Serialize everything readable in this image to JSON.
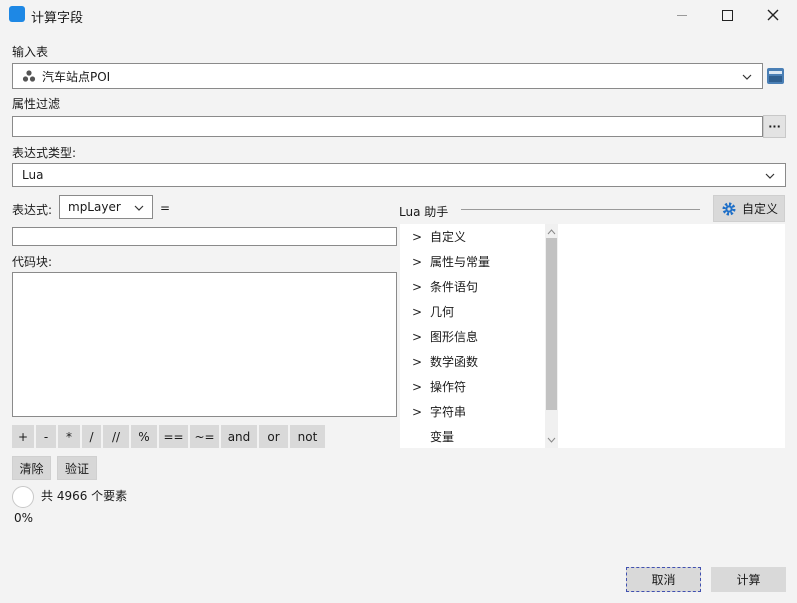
{
  "window": {
    "title": "计算字段",
    "minimize_icon": "minimize-icon",
    "maximize_icon": "maximize-icon",
    "close_icon": "close-icon"
  },
  "input_table": {
    "label": "输入表",
    "value": "汽车站点POI",
    "icon": "point-layer-icon"
  },
  "attr_filter": {
    "label": "属性过滤",
    "value": "",
    "button": "···"
  },
  "expr_type": {
    "label": "表达式类型:",
    "value": "Lua"
  },
  "expression": {
    "label": "表达式:",
    "field": "mpLayer",
    "equals": "=",
    "value": ""
  },
  "code_block": {
    "label": "代码块:",
    "value": ""
  },
  "operators": [
    "+",
    "-",
    "*",
    "/",
    "//",
    "%",
    "==",
    "~=",
    "and",
    "or",
    "not"
  ],
  "actions": {
    "clear": "清除",
    "verify": "验证"
  },
  "progress": {
    "count_text": "共 4966 个要素",
    "percent_text": "0%",
    "value": 0
  },
  "helper": {
    "title": "Lua 助手",
    "custom_button": "自定义",
    "items": [
      {
        "label": "自定义",
        "expandable": true
      },
      {
        "label": "属性与常量",
        "expandable": true
      },
      {
        "label": "条件语句",
        "expandable": true
      },
      {
        "label": "几何",
        "expandable": true
      },
      {
        "label": "图形信息",
        "expandable": true
      },
      {
        "label": "数学函数",
        "expandable": true
      },
      {
        "label": "操作符",
        "expandable": true
      },
      {
        "label": "字符串",
        "expandable": true
      },
      {
        "label": "变量",
        "expandable": false
      }
    ]
  },
  "footer": {
    "cancel": "取消",
    "compute": "计算"
  },
  "colors": {
    "accent": "#1e88e5",
    "bg": "#f3f3f3",
    "button": "#d9d9d9"
  }
}
